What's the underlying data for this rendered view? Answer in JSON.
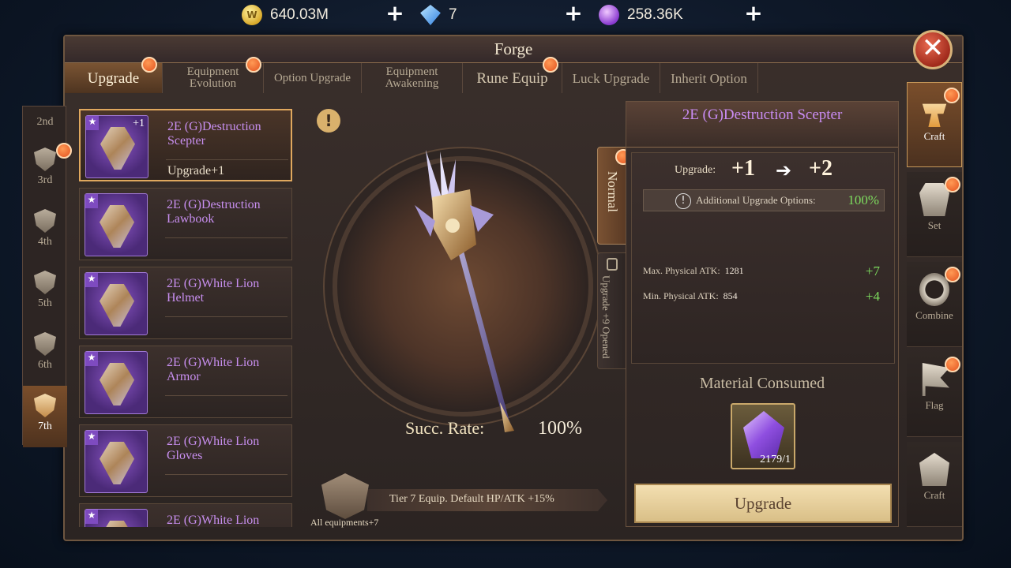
{
  "currencies": {
    "gold": {
      "value": "640.03M",
      "icon": "gold-coin-icon"
    },
    "diamond": {
      "value": "7",
      "icon": "diamond-icon"
    },
    "crystal": {
      "value": "258.36K",
      "icon": "crystal-icon"
    },
    "plus": "+"
  },
  "window": {
    "title": "Forge",
    "close": "✕"
  },
  "tabs": [
    {
      "label": "Upgrade",
      "active": true
    },
    {
      "label": "Equipment\nEvolution"
    },
    {
      "label": "Option Upgrade"
    },
    {
      "label": "Equipment\nAwakening"
    },
    {
      "label": "Rune Equip"
    },
    {
      "label": "Luck Upgrade"
    },
    {
      "label": "Inherit Option"
    }
  ],
  "tiers": [
    {
      "label": "2nd"
    },
    {
      "label": "3rd"
    },
    {
      "label": "4th"
    },
    {
      "label": "5th"
    },
    {
      "label": "6th"
    },
    {
      "label": "7th",
      "active": true
    }
  ],
  "items": [
    {
      "name": "2E (G)Destruction Scepter",
      "level": "+1",
      "sub": "Upgrade+1",
      "star": "★"
    },
    {
      "name": "2E (G)Destruction Lawbook",
      "star": "★"
    },
    {
      "name": "2E (G)White Lion Helmet",
      "star": "★"
    },
    {
      "name": "2E (G)White Lion Armor",
      "star": "★"
    },
    {
      "name": "2E (G)White Lion Gloves",
      "star": "★"
    },
    {
      "name": "2E (G)White Lion",
      "star": "★"
    }
  ],
  "center": {
    "warn": "!",
    "rate_label": "Succ. Rate:",
    "rate_value": "100%",
    "tier_text": "Tier 7 Equip. Default HP/ATK +15%",
    "all_equip": "All equipments+7"
  },
  "side_tabs": {
    "normal": "Normal",
    "locked": "Upgrade +9 Opened"
  },
  "detail": {
    "title": "2E (G)Destruction Scepter",
    "upgrade_label": "Upgrade:",
    "from": "+1",
    "arrow": "➔",
    "to": "+2",
    "add_options_label": "Additional Upgrade Options:",
    "add_options_value": "100%",
    "add_options_icon": "!",
    "stats": [
      {
        "label": "Max. Physical ATK:",
        "value": "1281",
        "inc": "+7"
      },
      {
        "label": "Min. Physical ATK:",
        "value": "854",
        "inc": "+4"
      }
    ],
    "material_label": "Material Consumed",
    "material_count": "2179/1",
    "button": "Upgrade"
  },
  "right_nav": [
    {
      "label": "Craft",
      "active": true,
      "icon": "anvil-icon"
    },
    {
      "label": "Set",
      "icon": "armor-set-icon"
    },
    {
      "label": "Combine",
      "icon": "combine-ring-icon"
    },
    {
      "label": "Flag",
      "icon": "flag-icon"
    },
    {
      "label": "Craft",
      "icon": "craft-helmet-icon"
    }
  ],
  "colors": {
    "accent_orange": "#e3521f",
    "item_name_purple": "#c88ff0",
    "stat_green": "#7ddc5e",
    "button_gold": "#e6cf98"
  }
}
